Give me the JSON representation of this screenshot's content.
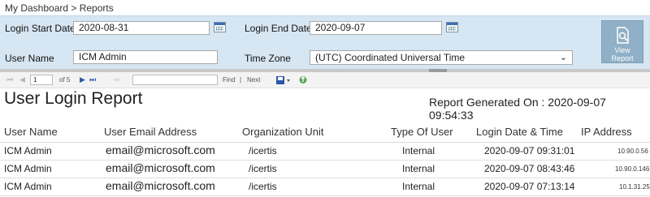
{
  "breadcrumb": "My Dashboard > Reports",
  "params": {
    "login_start_label": "Login Start Date",
    "login_start_value": "2020-08-31",
    "login_end_label": "Login End Date",
    "login_end_value": "2020-09-07",
    "user_name_label": "User Name",
    "user_name_value": "ICM Admin",
    "time_zone_label": "Time Zone",
    "time_zone_value": "(UTC) Coordinated Universal Time",
    "view_report_label_1": "View",
    "view_report_label_2": "Report"
  },
  "toolbar": {
    "page_value": "1",
    "page_of": "of 5",
    "find_label": "Find",
    "separator": "|",
    "next_label": "Next"
  },
  "report": {
    "title": "User Login Report",
    "generated": "Report Generated On : 2020-09-07 09:54:33",
    "columns": [
      "User Name",
      "User Email Address",
      "Organization Unit",
      "Type Of User",
      "Login Date & Time",
      "IP Address"
    ],
    "rows": [
      [
        "ICM Admin",
        "email@microsoft.com",
        "/icertis",
        "Internal",
        "2020-09-07 09:31:01",
        "10.90.0.56"
      ],
      [
        "ICM Admin",
        "email@microsoft.com",
        "/icertis",
        "Internal",
        "2020-09-07 08:43:46",
        "10.90.0.146"
      ],
      [
        "ICM Admin",
        "email@microsoft.com",
        "/icertis",
        "Internal",
        "2020-09-07 07:13:14",
        "10.1.31.25"
      ]
    ]
  },
  "colors": {
    "param_panel": "#d6e6f2",
    "view_button": "#8fb0c6",
    "toolbar_blue": "#2c57a8"
  },
  "icons": [
    "calendar-icon",
    "chevron-down-icon",
    "view-report-icon",
    "first-page-icon",
    "previous-page-icon",
    "next-page-icon",
    "last-page-icon",
    "back-icon",
    "export-icon",
    "refresh-icon"
  ]
}
